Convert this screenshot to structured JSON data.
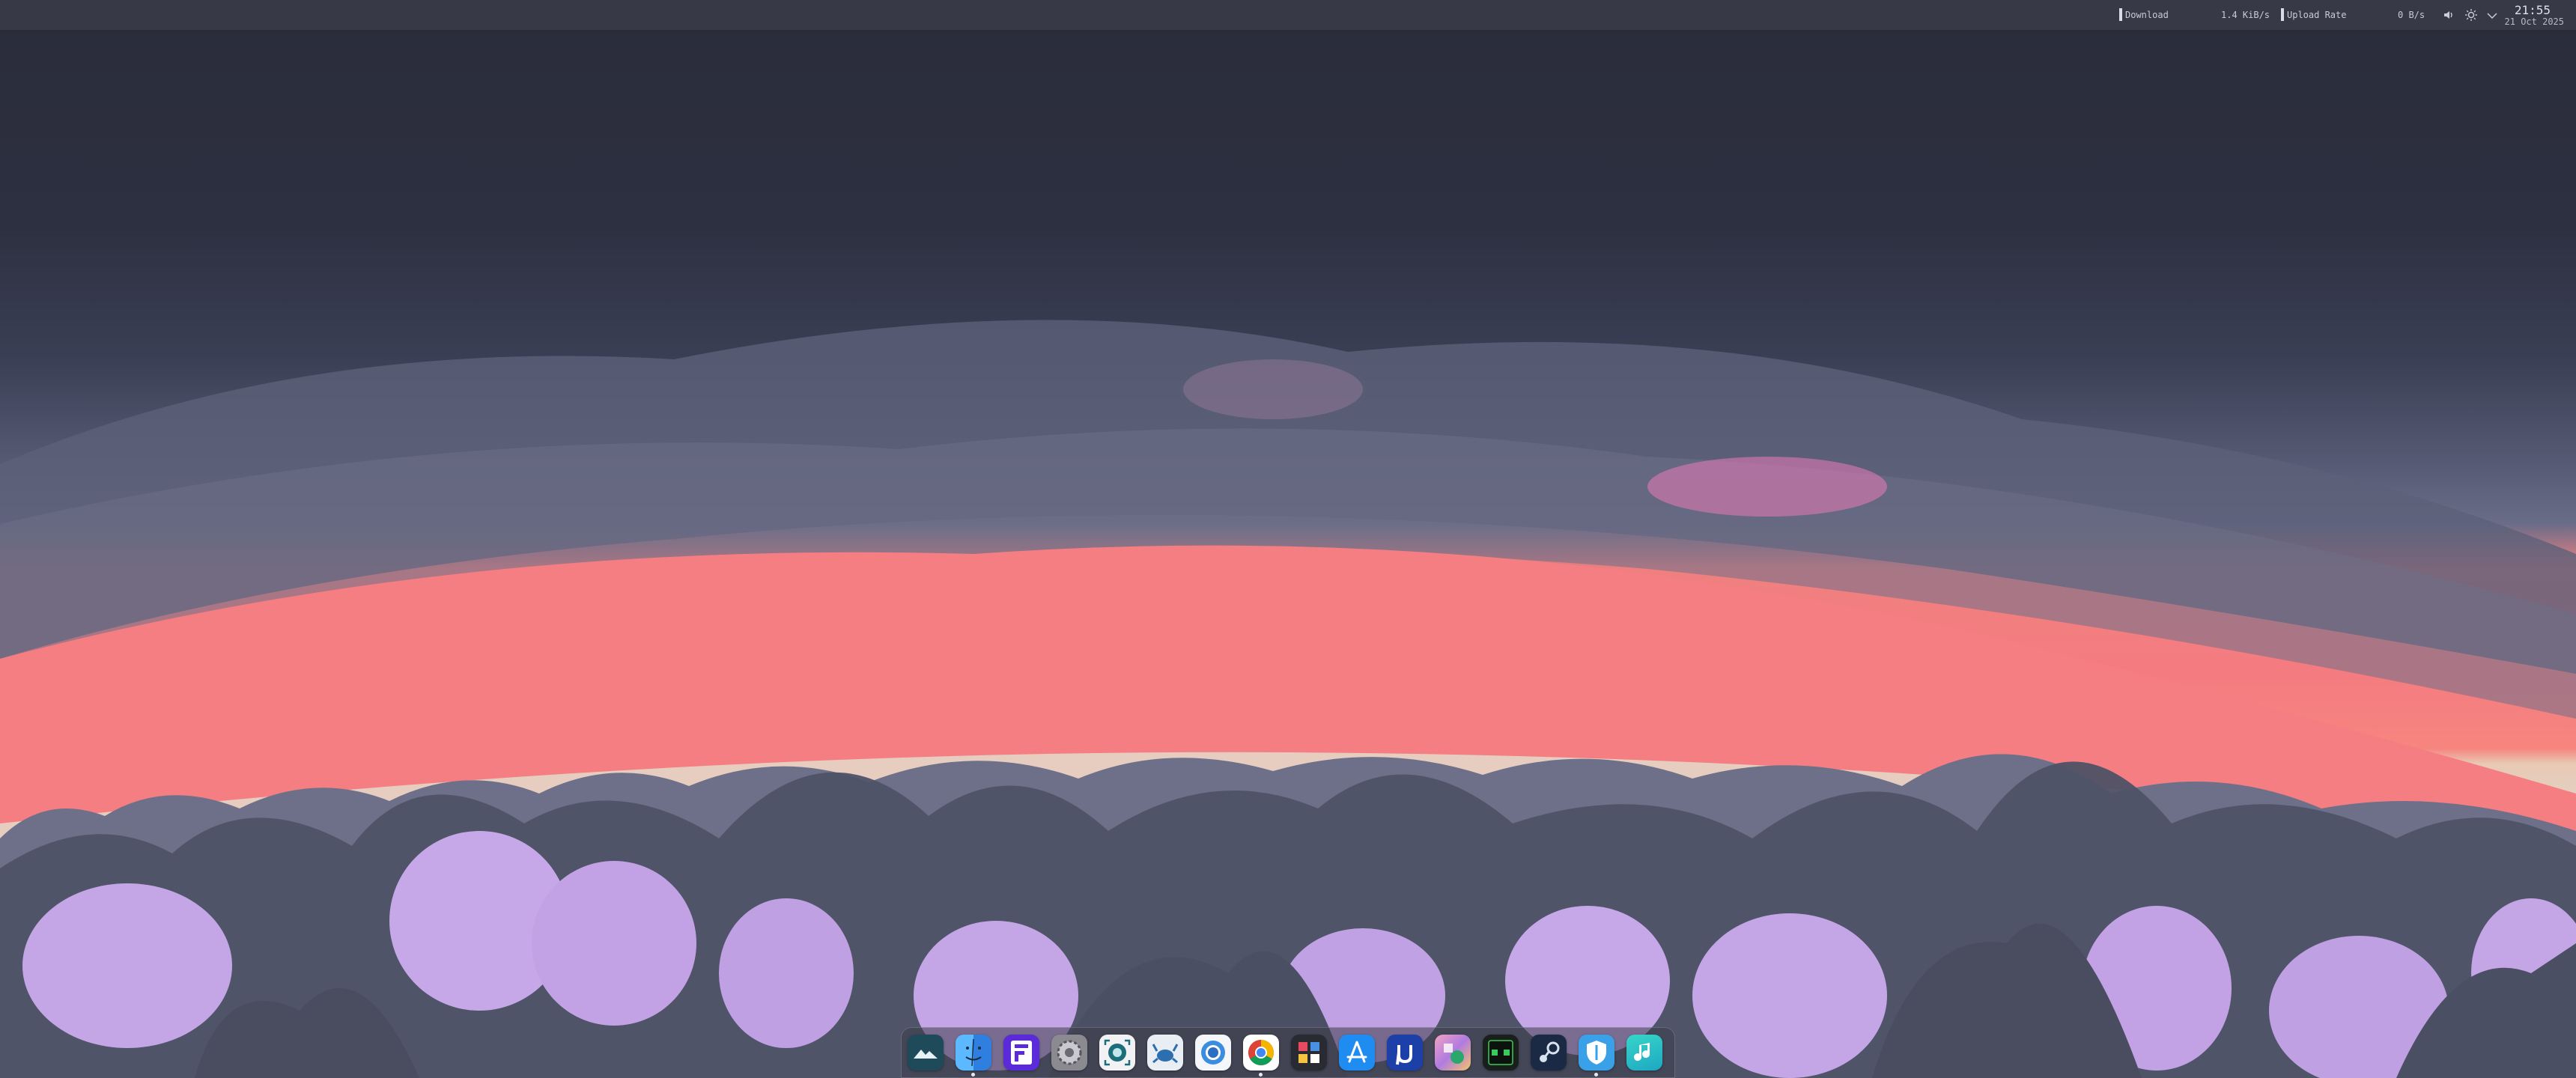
{
  "menubar": {
    "download_label": "Download",
    "download_rate": "1.4 KiB/s",
    "upload_label": "Upload Rate",
    "upload_rate": "0 B/s",
    "tray_icons": [
      "volume-icon",
      "brightness-icon",
      "chevron-down-icon"
    ],
    "clock_time": "21:55",
    "clock_date": "21 Oct 2025"
  },
  "dock": {
    "apps": [
      {
        "name": "mountain-app-icon",
        "color": "#1f4a5a"
      },
      {
        "name": "finder-icon",
        "color": "#2f8ff0"
      },
      {
        "name": "fleet-app-icon",
        "color": "#5b2ad9"
      },
      {
        "name": "system-settings-icon",
        "color": "#8a8a90"
      },
      {
        "name": "screenshot-app-icon",
        "color": "#f2f2f4"
      },
      {
        "name": "crab-app-icon",
        "color": "#e9eef5"
      },
      {
        "name": "chromium-icon",
        "color": "#f4f6fa"
      },
      {
        "name": "chrome-icon",
        "color": "#ffffff"
      },
      {
        "name": "raycast-icon",
        "color": "#2a2a32"
      },
      {
        "name": "app-store-icon",
        "color": "#1e8cf0"
      },
      {
        "name": "utorrent-icon",
        "color": "#1c3fa8"
      },
      {
        "name": "bbedit-app-icon",
        "color": "#d98aa8"
      },
      {
        "name": "activity-monitor-icon",
        "color": "#1a1f1c"
      },
      {
        "name": "steam-icon",
        "color": "#1b2a44"
      },
      {
        "name": "vpn-shield-icon",
        "color": "#3aa0e8"
      },
      {
        "name": "music-icon",
        "color": "#29c6c0"
      }
    ]
  }
}
